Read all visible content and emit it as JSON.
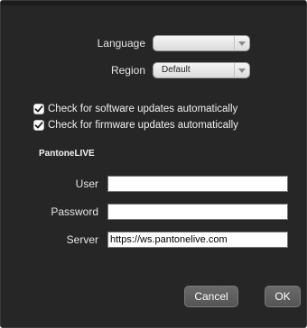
{
  "preferences": {
    "language_label": "Language",
    "language_value": "",
    "region_label": "Region",
    "region_value": "Default",
    "check_software_label": "Check for software updates automatically",
    "check_software_checked": true,
    "check_firmware_label": "Check for firmware updates automatically",
    "check_firmware_checked": true
  },
  "pantonelive": {
    "section_title": "PantoneLIVE",
    "user_label": "User",
    "user_value": "",
    "password_label": "Password",
    "password_value": "",
    "server_label": "Server",
    "server_value": "https://ws.pantonelive.com"
  },
  "buttons": {
    "cancel_label": "Cancel",
    "ok_label": "OK"
  },
  "icons": {
    "checkmark": "check-icon",
    "dropdown": "chevron-down-icon"
  },
  "colors": {
    "dialog_background": "#262626",
    "button_background": "#5f5f5f",
    "checkbox_background": "#ffffff"
  }
}
